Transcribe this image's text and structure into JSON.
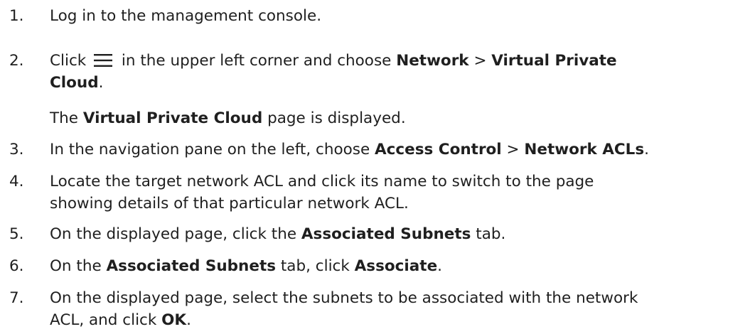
{
  "steps": [
    {
      "num": "1.",
      "text": "Log in to the management console."
    },
    {
      "num": "2.",
      "l1_a": "Click ",
      "l1_b": " in the upper left corner and choose ",
      "l1_c": "Network",
      "l1_d": " > ",
      "l1_e": "Virtual Private",
      "l2_a": "Cloud",
      "l2_b": ".",
      "icon": "menu-icon",
      "note_a": "The ",
      "note_b": "Virtual Private Cloud",
      "note_c": " page is displayed."
    },
    {
      "num": "3.",
      "a": "In the navigation pane on the left, choose ",
      "b": "Access Control",
      "c": " > ",
      "d": "Network ACLs",
      "e": "."
    },
    {
      "num": "4.",
      "l1": "Locate the target network ACL and click its name to switch to the page",
      "l2": "showing details of that particular network ACL."
    },
    {
      "num": "5.",
      "a": "On the displayed page, click the ",
      "b": "Associated Subnets",
      "c": " tab."
    },
    {
      "num": "6.",
      "a": "On the ",
      "b": "Associated Subnets",
      "c": " tab, click ",
      "d": "Associate",
      "e": "."
    },
    {
      "num": "7.",
      "l1": "On the displayed page, select the subnets to be associated with the network",
      "l2_a": "ACL, and click ",
      "l2_b": "OK",
      "l2_c": "."
    }
  ]
}
